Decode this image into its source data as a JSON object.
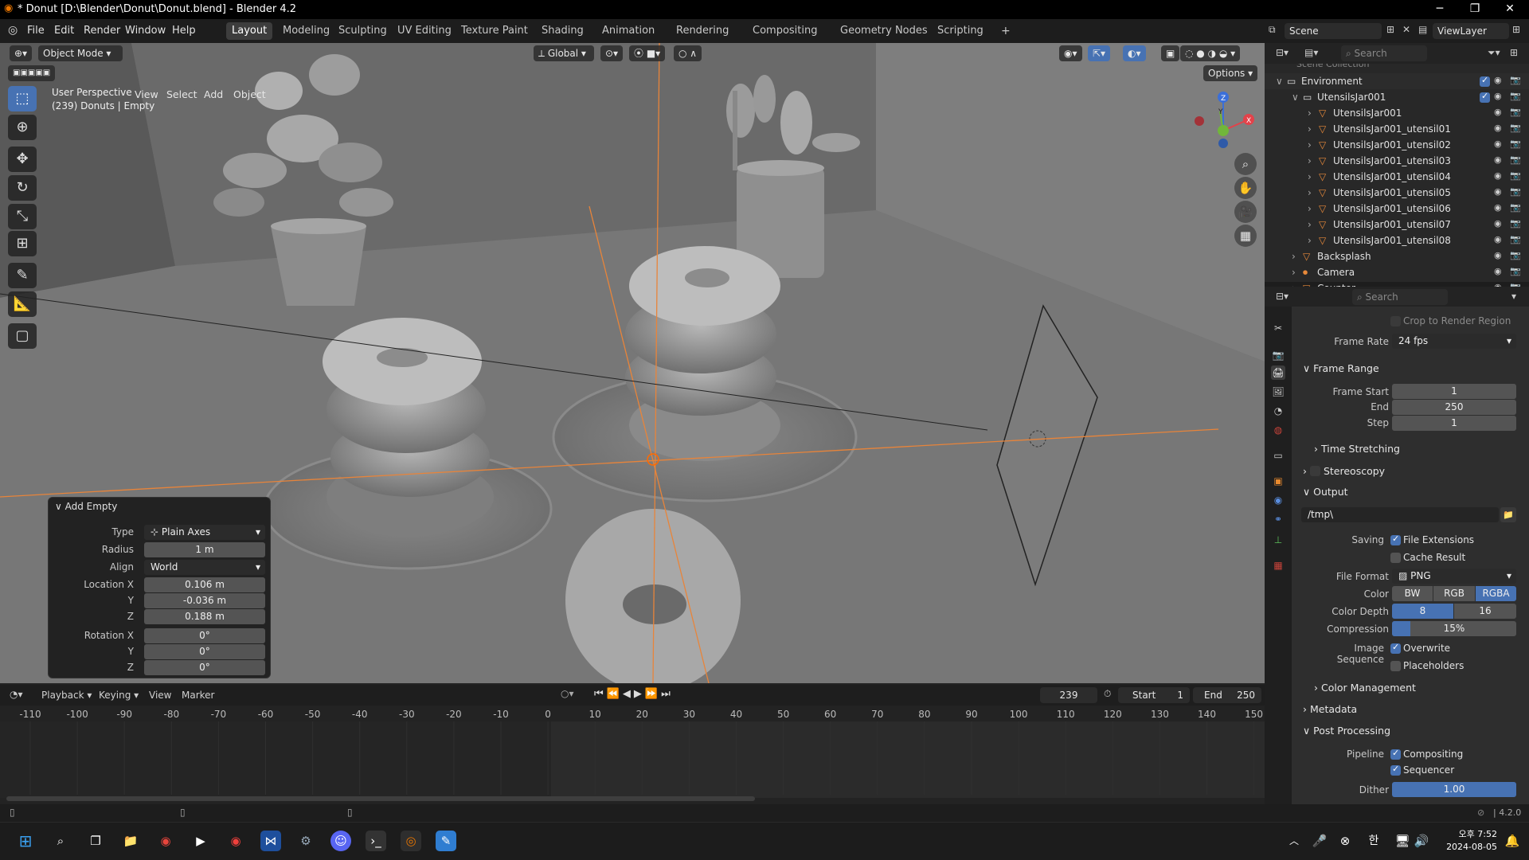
{
  "window": {
    "title": "* Donut [D:\\Blender\\Donut\\Donut.blend] - Blender 4.2"
  },
  "menu": [
    "File",
    "Edit",
    "Render",
    "Window",
    "Help"
  ],
  "workspaces": [
    "Layout",
    "Modeling",
    "Sculpting",
    "UV Editing",
    "Texture Paint",
    "Shading",
    "Animation",
    "Rendering",
    "Compositing",
    "Geometry Nodes",
    "Scripting"
  ],
  "scene": {
    "name": "Scene",
    "view_layer": "ViewLayer"
  },
  "viewport": {
    "mode": "Object Mode",
    "menus": [
      "View",
      "Select",
      "Add",
      "Object"
    ],
    "orientation": "Global",
    "options": "Options",
    "info_line1": "User Perspective",
    "info_line2": "(239) Donuts | Empty",
    "gizmo": {
      "z": "Z",
      "y": "Y",
      "x": "X"
    }
  },
  "add_empty": {
    "title": "Add Empty",
    "type_label": "Type",
    "type_value": "Plain Axes",
    "radius_label": "Radius",
    "radius_value": "1 m",
    "align_label": "Align",
    "align_value": "World",
    "location_label": "Location X",
    "loc_x": "0.106 m",
    "y_label": "Y",
    "loc_y": "-0.036 m",
    "z_label": "Z",
    "loc_z": "0.188 m",
    "rotation_label": "Rotation X",
    "rot_x": "0°",
    "rot_y_label": "Y",
    "rot_y": "0°",
    "rot_z_label": "Z",
    "rot_z": "0°"
  },
  "timeline": {
    "menus": [
      "Playback",
      "Keying",
      "View",
      "Marker"
    ],
    "current_frame": "239",
    "start_label": "Start",
    "start": "1",
    "end_label": "End",
    "end": "250",
    "ticks": [
      "-110",
      "-100",
      "-90",
      "-80",
      "-70",
      "-60",
      "-50",
      "-40",
      "-30",
      "-20",
      "-10",
      "0",
      "10",
      "20",
      "30",
      "40",
      "50",
      "60",
      "70",
      "80",
      "90",
      "100",
      "110",
      "120",
      "130",
      "140",
      "150"
    ]
  },
  "outliner": {
    "search_placeholder": "Search",
    "top_partial": "Scene Collection",
    "rows": [
      {
        "label": "Environment",
        "indent": 0
      },
      {
        "label": "UtensilsJar001",
        "indent": 1
      },
      {
        "label": "UtensilsJar001",
        "indent": 2
      },
      {
        "label": "UtensilsJar001_utensil01",
        "indent": 2
      },
      {
        "label": "UtensilsJar001_utensil02",
        "indent": 2
      },
      {
        "label": "UtensilsJar001_utensil03",
        "indent": 2
      },
      {
        "label": "UtensilsJar001_utensil04",
        "indent": 2
      },
      {
        "label": "UtensilsJar001_utensil05",
        "indent": 2
      },
      {
        "label": "UtensilsJar001_utensil06",
        "indent": 2
      },
      {
        "label": "UtensilsJar001_utensil07",
        "indent": 2
      },
      {
        "label": "UtensilsJar001_utensil08",
        "indent": 2
      },
      {
        "label": "Backsplash",
        "indent": 1
      },
      {
        "label": "Camera",
        "indent": 1
      },
      {
        "label": "Counter",
        "indent": 1
      }
    ]
  },
  "properties": {
    "search_placeholder": "Search",
    "crop_label": "Crop to Render Region",
    "frame_rate_label": "Frame Rate",
    "frame_rate": "24 fps",
    "frame_range": "Frame Range",
    "frame_start_label": "Frame Start",
    "frame_start": "1",
    "end_label": "End",
    "end": "250",
    "step_label": "Step",
    "step": "1",
    "time_stretching": "Time Stretching",
    "stereoscopy": "Stereoscopy",
    "output": "Output",
    "output_path": "/tmp\\",
    "saving_label": "Saving",
    "file_extensions": "File Extensions",
    "cache_result": "Cache Result",
    "file_format_label": "File Format",
    "file_format": "PNG",
    "color_label": "Color",
    "color_bw": "BW",
    "color_rgb": "RGB",
    "color_rgba": "RGBA",
    "color_depth_label": "Color Depth",
    "depth_8": "8",
    "depth_16": "16",
    "compression_label": "Compression",
    "compression": "15%",
    "compression_fraction": 0.15,
    "image_sequence_label": "Image Sequence",
    "overwrite": "Overwrite",
    "placeholders": "Placeholders",
    "color_management": "Color Management",
    "metadata": "Metadata",
    "post_processing": "Post Processing",
    "pipeline_label": "Pipeline",
    "compositing": "Compositing",
    "sequencer": "Sequencer",
    "dither_label": "Dither",
    "dither": "1.00"
  },
  "status": {
    "version": "4.2.0"
  },
  "taskbar": {
    "time": "오후 7:52",
    "date": "2024-08-05",
    "ime": "한"
  }
}
